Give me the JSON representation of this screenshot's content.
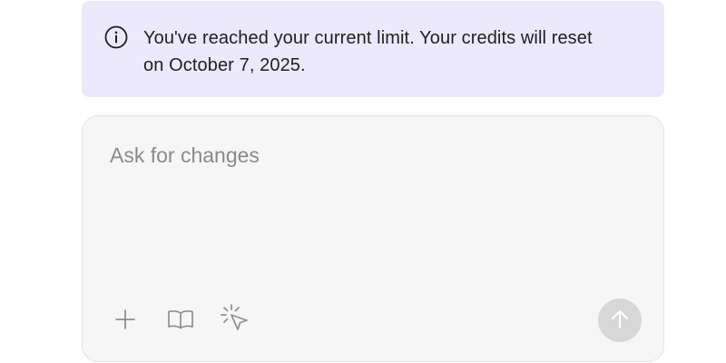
{
  "notice": {
    "message": "You've reached your current limit. Your credits will reset on October 7, 2025.",
    "icon": "info-icon",
    "background_color": "#ebe9fb"
  },
  "composer": {
    "placeholder": "Ask for changes",
    "value": "",
    "background_color": "#f6f6f6",
    "tools": [
      {
        "name": "add",
        "icon": "plus-icon"
      },
      {
        "name": "knowledge",
        "icon": "book-icon"
      },
      {
        "name": "select-element",
        "icon": "cursor-click-icon"
      }
    ],
    "send": {
      "icon": "arrow-up-icon",
      "enabled": false,
      "color": "#d7d7d7"
    }
  }
}
